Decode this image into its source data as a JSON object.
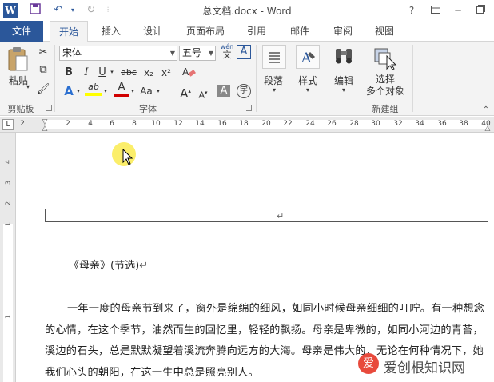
{
  "app": {
    "logo_letter": "W",
    "title": "总文档.docx - Word",
    "help": "?",
    "undo_icon": "↶",
    "redo_icon": "↻",
    "save_icon": "🖫",
    "min": "─",
    "restore": "🗗",
    "close": "✕",
    "ribbon_display": "🗔"
  },
  "tabs": [
    {
      "label": "文件"
    },
    {
      "label": "开始"
    },
    {
      "label": "插入"
    },
    {
      "label": "设计"
    },
    {
      "label": "页面布局"
    },
    {
      "label": "引用"
    },
    {
      "label": "邮件"
    },
    {
      "label": "审阅"
    },
    {
      "label": "视图"
    }
  ],
  "ribbon": {
    "clipboard": {
      "paste": "粘贴",
      "group": "剪贴板"
    },
    "font": {
      "font_name": "宋体",
      "font_size": "五号",
      "group": "字体",
      "wen": "wén",
      "wen_char": "文",
      "bold": "B",
      "italic": "I",
      "underline": "U",
      "strike": "abc",
      "sub": "x₂",
      "sup": "x²",
      "text_effect": "A",
      "highlight": "ab",
      "font_color": "A",
      "aa": "Aa",
      "grow": "A",
      "shrink": "A",
      "char_shade": "A",
      "enclose": "字"
    },
    "paragraph": {
      "label": "段落"
    },
    "styles": {
      "label": "样式"
    },
    "editing": {
      "label": "编辑"
    },
    "select": {
      "label": "选择\n多个对象",
      "label1": "选择",
      "label2": "多个对象",
      "group": "新建组"
    }
  },
  "ruler": {
    "ticks": [
      "2",
      "2",
      "4",
      "6",
      "8",
      "10",
      "12",
      "14",
      "16",
      "18",
      "20",
      "22",
      "24",
      "26",
      "28",
      "30",
      "32",
      "34",
      "36",
      "38",
      "40"
    ],
    "vticks": [
      "4",
      "3",
      "2",
      "1",
      "1"
    ],
    "tab_stop": "L"
  },
  "document": {
    "header_para_mark": "↵",
    "title": "《母亲》(节选)↵",
    "paragraph": "一年一度的母亲节到来了，窗外是绵绵的细风，如同小时候母亲细细的叮咛。有一种想念的心情，在这个季节，油然而生的回忆里，轻轻的飘扬。母亲是卑微的，如同小河边的青苔，溪边的石头，总是默默凝望着溪流奔腾向远方的大海。母亲是伟大的，无论在何种情况下，她我们心头的朝阳，在这一生中总是照亮别人。"
  },
  "watermark": {
    "text": "爱创根知识网",
    "logo": "爱"
  },
  "colors": {
    "accent": "#2b579a",
    "highlight_yellow": "#ffff00",
    "font_red": "#d00000"
  }
}
